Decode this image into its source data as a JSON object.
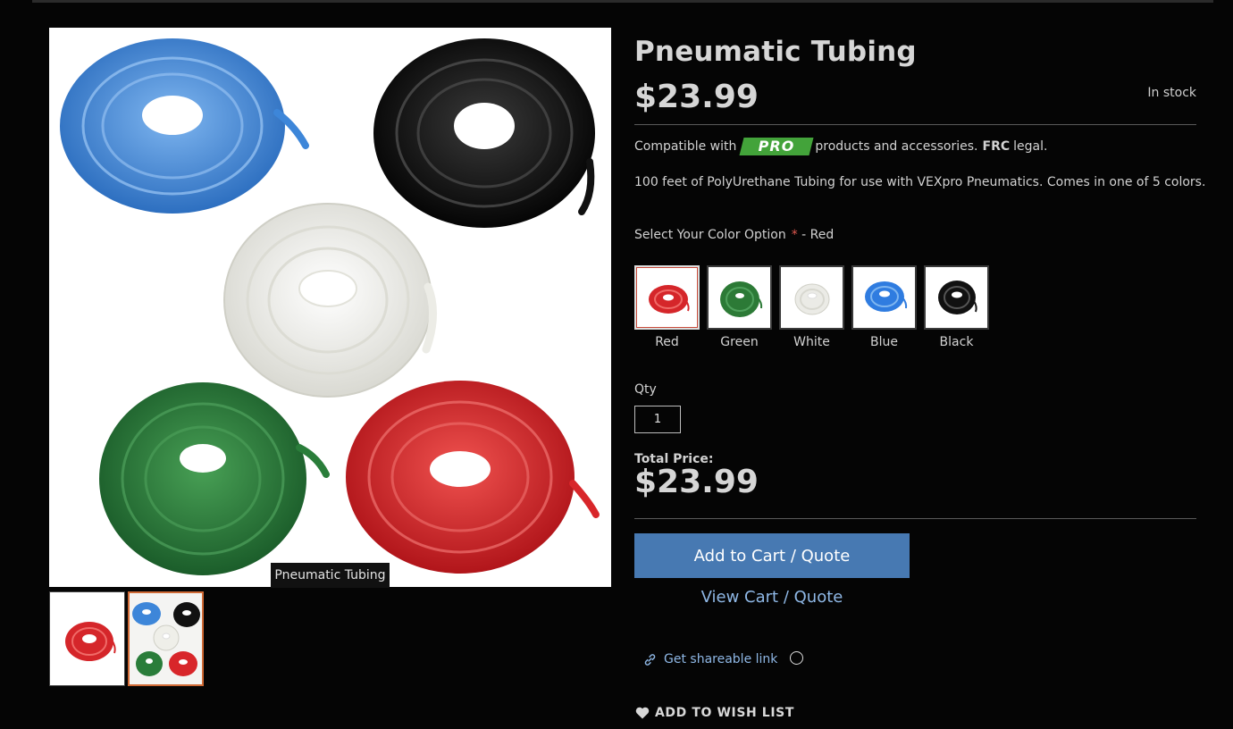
{
  "product": {
    "title": "Pneumatic Tubing",
    "price": "$23.99",
    "stock": "In stock",
    "compat_prefix": "Compatible with",
    "pro_badge": "PRO",
    "compat_suffix": "products and accessories.",
    "frc": "FRC",
    "frc_suffix": "legal.",
    "description": "100 feet of PolyUrethane Tubing for use with VEXpro Pneumatics. Comes in one of 5 colors."
  },
  "gallery": {
    "caption": "Pneumatic Tubing",
    "main_colors": [
      "#3d86d9",
      "#111111",
      "#f2f2ee",
      "#2a7d3a",
      "#d8262a"
    ]
  },
  "options": {
    "label": "Select Your Color Option",
    "required_mark": "*",
    "selected_text": "- Red",
    "swatches": [
      {
        "label": "Red",
        "color": "#d5262a",
        "selected": true
      },
      {
        "label": "Green",
        "color": "#2c7a36",
        "selected": false
      },
      {
        "label": "White",
        "color": "#e9e9e4",
        "selected": false
      },
      {
        "label": "Blue",
        "color": "#2f7ce0",
        "selected": false
      },
      {
        "label": "Black",
        "color": "#111111",
        "selected": false
      }
    ]
  },
  "quantity": {
    "label": "Qty",
    "value": "1"
  },
  "total": {
    "label": "Total Price:",
    "value": "$23.99"
  },
  "actions": {
    "add_to_cart": "Add to Cart / Quote",
    "view_cart": "View Cart / Quote",
    "share": "Get shareable link",
    "wishlist": "ADD TO WISH LIST"
  },
  "colors": {
    "accent": "#4779b2",
    "link": "#8fb8e6",
    "pro_green": "#43a33a",
    "required": "#e0584f",
    "thumb_active_border": "#d06a35"
  }
}
